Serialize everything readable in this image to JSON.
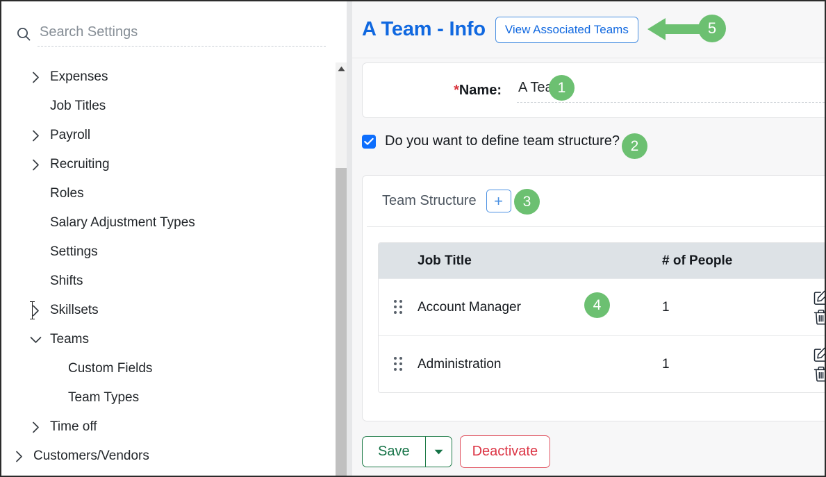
{
  "sidebar": {
    "search": {
      "placeholder": "Search Settings",
      "value": "",
      "icon": "search-icon"
    },
    "items": [
      {
        "label": "Expenses",
        "level": 1,
        "chevron": "right"
      },
      {
        "label": "Job Titles",
        "level": 1,
        "chevron": "none"
      },
      {
        "label": "Payroll",
        "level": 1,
        "chevron": "right"
      },
      {
        "label": "Recruiting",
        "level": 1,
        "chevron": "right"
      },
      {
        "label": "Roles",
        "level": 1,
        "chevron": "none"
      },
      {
        "label": "Salary Adjustment Types",
        "level": 1,
        "chevron": "none"
      },
      {
        "label": "Settings",
        "level": 1,
        "chevron": "none"
      },
      {
        "label": "Shifts",
        "level": 1,
        "chevron": "none"
      },
      {
        "label": "Skillsets",
        "level": 1,
        "chevron": "right",
        "caret": true
      },
      {
        "label": "Teams",
        "level": 1,
        "chevron": "down"
      },
      {
        "label": "Custom Fields",
        "level": 2,
        "chevron": "none"
      },
      {
        "label": "Team Types",
        "level": 2,
        "chevron": "none"
      },
      {
        "label": "Time off",
        "level": 1,
        "chevron": "right"
      },
      {
        "label": "Customers/Vendors",
        "level": 0,
        "chevron": "right"
      }
    ],
    "scrollbar": {
      "up_arrow_icon": "scroll-up-arrow-icon"
    }
  },
  "main": {
    "header": {
      "title": "A Team - Info",
      "view_associated_teams_label": "View Associated Teams"
    },
    "name_field": {
      "label": "Name:",
      "required_marker": "*",
      "value": "A Team",
      "placeholder": ""
    },
    "define_structure": {
      "label": "Do you want to define team structure?",
      "checked": true
    },
    "team_structure": {
      "title": "Team Structure",
      "add_button_label": "+",
      "table": {
        "columns": [
          "Job Title",
          "# of People"
        ],
        "rows": [
          {
            "job_title": "Account Manager",
            "people": "1"
          },
          {
            "job_title": "Administration",
            "people": "1"
          }
        ],
        "row_actions": [
          "edit-icon",
          "delete-icon"
        ],
        "drag_handle_icon": "drag-handle-icon"
      }
    },
    "footer": {
      "save_label": "Save",
      "save_caret_icon": "caret-down-icon",
      "deactivate_label": "Deactivate"
    }
  },
  "callouts": {
    "accent_color": "#6cc071",
    "badges": [
      {
        "number": "1",
        "target": "name-value"
      },
      {
        "number": "2",
        "target": "define-structure-checkbox-label"
      },
      {
        "number": "3",
        "target": "add-structure-button"
      },
      {
        "number": "4",
        "target": "table-row-account-manager"
      },
      {
        "number": "5",
        "target": "view-associated-teams-button"
      }
    ],
    "arrow": {
      "direction": "left",
      "color": "#6cc071"
    }
  },
  "colors": {
    "title_blue": "#1068e0",
    "checkbox_blue": "#0d6efd",
    "save_green": "#157347",
    "deactivate_red": "#dc3545",
    "required_red": "#d9363e",
    "table_header_bg": "#dde2e6",
    "callout_green": "#6cc071"
  }
}
